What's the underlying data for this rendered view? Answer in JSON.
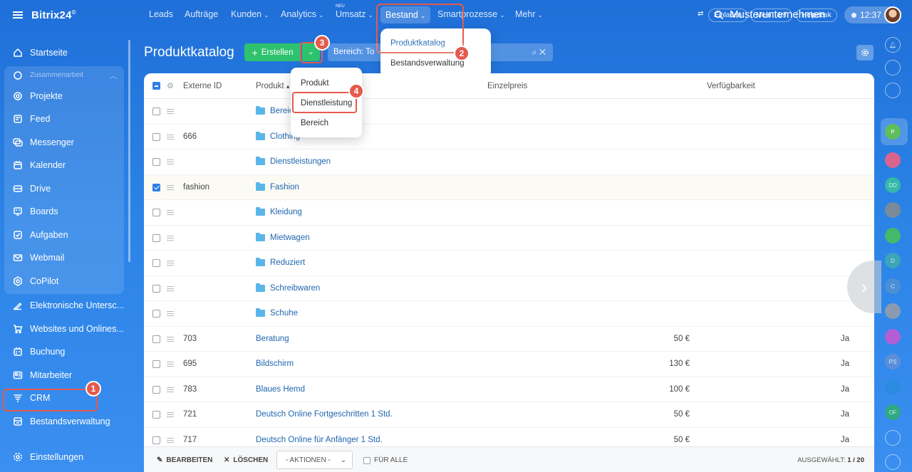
{
  "sidebar": {
    "logo": "Bitrix24",
    "logo_mark": "©",
    "group_label": "Zusammenarbeit",
    "items": [
      {
        "label": "Startseite",
        "icon": "home-icon"
      },
      {
        "label": "Projekte",
        "icon": "projects-icon"
      },
      {
        "label": "Feed",
        "icon": "feed-icon"
      },
      {
        "label": "Messenger",
        "icon": "messenger-icon"
      },
      {
        "label": "Kalender",
        "icon": "calendar-icon"
      },
      {
        "label": "Drive",
        "icon": "drive-icon"
      },
      {
        "label": "Boards",
        "icon": "boards-icon"
      },
      {
        "label": "Aufgaben",
        "icon": "tasks-icon"
      },
      {
        "label": "Webmail",
        "icon": "mail-icon"
      },
      {
        "label": "CoPilot",
        "icon": "copilot-icon"
      },
      {
        "label": "Elektronische Untersc...",
        "icon": "signature-icon"
      },
      {
        "label": "Websites und Onlines...",
        "icon": "cart-icon"
      },
      {
        "label": "Buchung",
        "icon": "booking-icon"
      },
      {
        "label": "Mitarbeiter",
        "icon": "employees-icon"
      },
      {
        "label": "CRM",
        "icon": "crm-icon"
      },
      {
        "label": "Bestandsverwaltung",
        "icon": "inventory-icon"
      },
      {
        "label": "Einstellungen",
        "icon": "settings-icon"
      }
    ]
  },
  "topnav": {
    "items": [
      "Leads",
      "Aufträge",
      "Kunden",
      "Analytics",
      "Umsatz",
      "Bestand",
      "Smartprozesse",
      "Mehr"
    ],
    "new_badge": "NEU",
    "company": "Musterunternehmen",
    "invite": "Einladen",
    "tariff": "Mein Tarif",
    "helpdesk": "Helpdesk",
    "time": "12:37"
  },
  "bestand_menu": [
    "Produktkatalog",
    "Bestandsverwaltung"
  ],
  "page": {
    "title": "Produktkatalog",
    "create_label": "Erstellen",
    "filter_chip": "Bereich: To"
  },
  "create_menu": [
    "Produkt",
    "Dienstleistung",
    "Bereich"
  ],
  "grid": {
    "headers": {
      "ext": "Externe ID",
      "product": "Produkt",
      "price": "Einzelpreis",
      "avail": "Verfügbarkeit"
    },
    "rows": [
      {
        "ext": "",
        "product": "Bereich",
        "folder": true,
        "price": "",
        "avail": "",
        "checked": false
      },
      {
        "ext": "666",
        "product": "Clothing",
        "folder": true,
        "price": "",
        "avail": "",
        "checked": false
      },
      {
        "ext": "",
        "product": "Dienstleistungen",
        "folder": true,
        "price": "",
        "avail": "",
        "checked": false
      },
      {
        "ext": "fashion",
        "product": "Fashion",
        "folder": true,
        "price": "",
        "avail": "",
        "checked": true
      },
      {
        "ext": "",
        "product": "Kleidung",
        "folder": true,
        "price": "",
        "avail": "",
        "checked": false
      },
      {
        "ext": "",
        "product": "Mietwagen",
        "folder": true,
        "price": "",
        "avail": "",
        "checked": false
      },
      {
        "ext": "",
        "product": "Reduziert",
        "folder": true,
        "price": "",
        "avail": "",
        "checked": false
      },
      {
        "ext": "",
        "product": "Schreibwaren",
        "folder": true,
        "price": "",
        "avail": "",
        "checked": false
      },
      {
        "ext": "",
        "product": "Schuhe",
        "folder": true,
        "price": "",
        "avail": "",
        "checked": false
      },
      {
        "ext": "703",
        "product": "Beratung",
        "folder": false,
        "price": "50 €",
        "avail": "Ja",
        "checked": false
      },
      {
        "ext": "695",
        "product": "Bildschirm",
        "folder": false,
        "price": "130 €",
        "avail": "Ja",
        "checked": false
      },
      {
        "ext": "783",
        "product": "Blaues Hemd",
        "folder": false,
        "price": "100 €",
        "avail": "Ja",
        "checked": false
      },
      {
        "ext": "721",
        "product": "Deutsch Online Fortgeschritten 1 Std.",
        "folder": false,
        "price": "50 €",
        "avail": "Ja",
        "checked": false
      },
      {
        "ext": "717",
        "product": "Deutsch Online für Anfänger 1 Std.",
        "folder": false,
        "price": "50 €",
        "avail": "Ja",
        "checked": false
      }
    ]
  },
  "actionbar": {
    "edit": "BEARBEITEN",
    "delete": "LÖSCHEN",
    "actions": "- AKTIONEN -",
    "for_all": "FÜR ALLE",
    "selected_label": "AUSGEWÄHLT:",
    "selected_value": "1 / 20"
  },
  "rail_avatars": [
    "P",
    "DD",
    "D",
    "C",
    "PS",
    "OF"
  ],
  "badges": [
    "1",
    "2",
    "3",
    "4"
  ],
  "colors": {
    "accent_red": "#e55a4e",
    "create_green": "#2fc26e",
    "link_blue": "#2067b0"
  }
}
